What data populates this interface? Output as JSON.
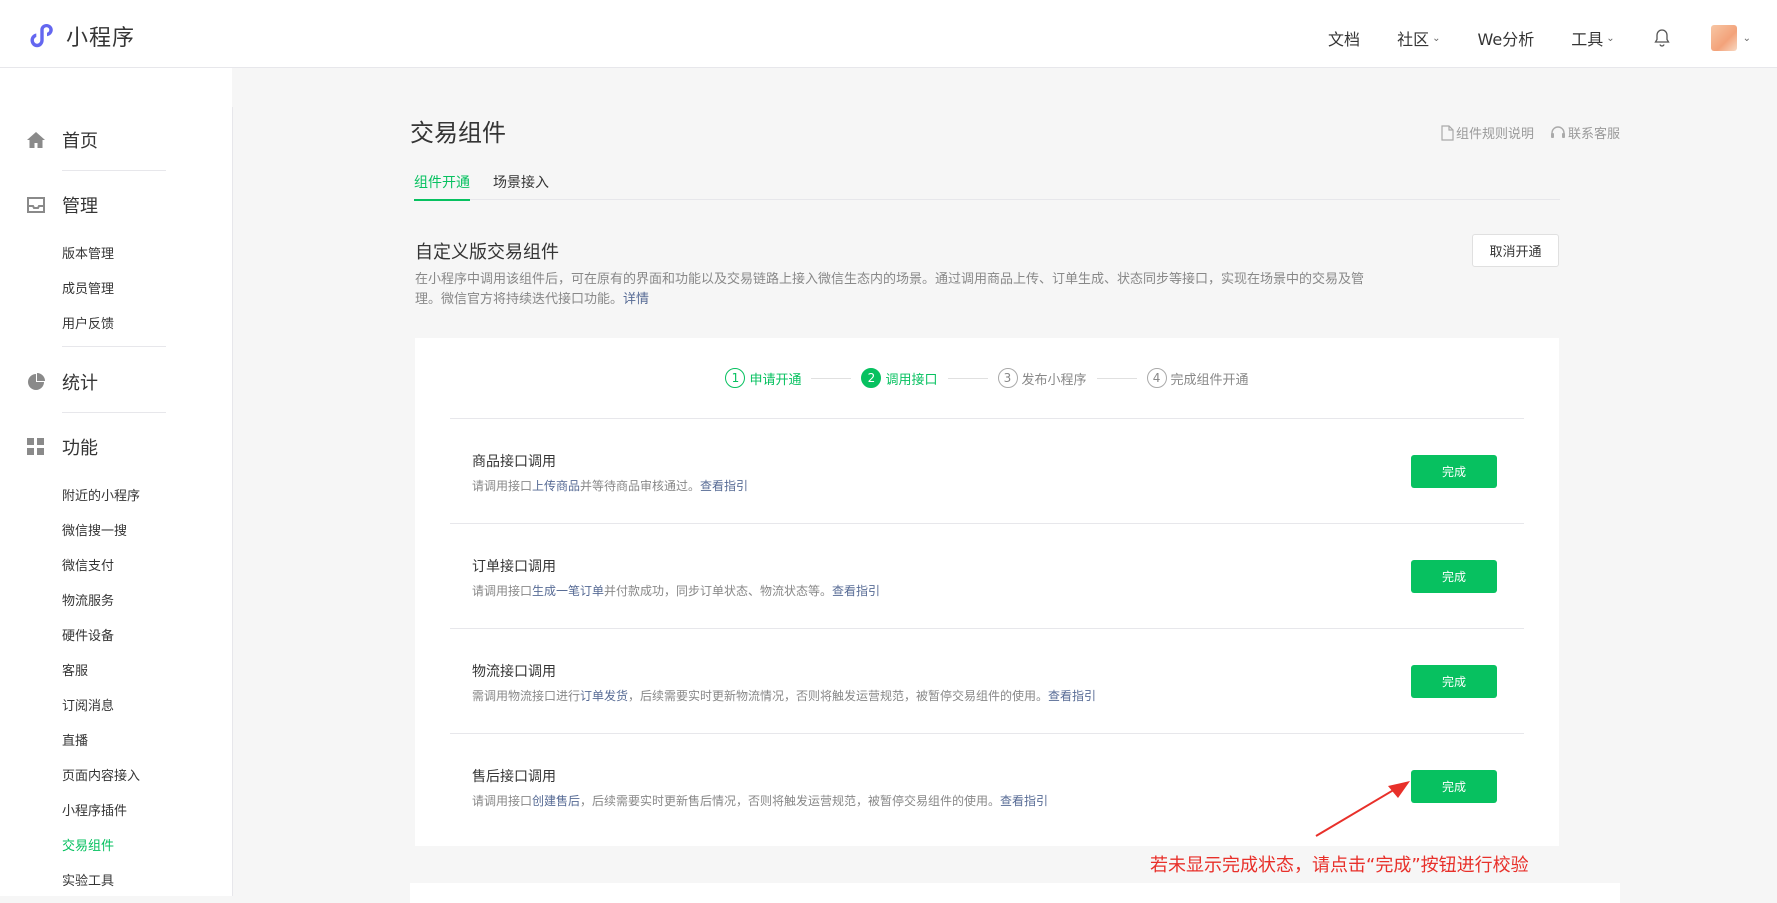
{
  "header": {
    "logo_text": "小程序",
    "nav": [
      {
        "label": "文档",
        "has_dropdown": false
      },
      {
        "label": "社区",
        "has_dropdown": true
      },
      {
        "label": "We分析",
        "has_dropdown": false
      },
      {
        "label": "工具",
        "has_dropdown": true
      }
    ],
    "bell_icon": "bell-icon",
    "avatar_icon": "avatar"
  },
  "sidebar": {
    "groups": [
      {
        "label": "首页",
        "icon": "home-icon",
        "items": []
      },
      {
        "label": "管理",
        "icon": "inbox-icon",
        "items": [
          "版本管理",
          "成员管理",
          "用户反馈"
        ]
      },
      {
        "label": "统计",
        "icon": "pie-chart-icon",
        "items": []
      },
      {
        "label": "功能",
        "icon": "grid-icon",
        "items": [
          "附近的小程序",
          "微信搜一搜",
          "微信支付",
          "物流服务",
          "硬件设备",
          "客服",
          "订阅消息",
          "直播",
          "页面内容接入",
          "小程序插件",
          "交易组件",
          "实验工具"
        ]
      }
    ],
    "active_item": "交易组件"
  },
  "page": {
    "title": "交易组件",
    "links": [
      "组件规则说明",
      "联系客服"
    ],
    "tabs": [
      {
        "label": "组件开通",
        "active": true
      },
      {
        "label": "场景接入",
        "active": false
      }
    ],
    "section_title": "自定义版交易组件",
    "cancel_button": "取消开通",
    "description_line1": "在小程序中调用该组件后，可在原有的界面和功能以及交易链路上接入微信生态内的场景。通过调用商品上传、订单生成、状态同步等接口，实现在场景中的交易及管理。微",
    "description_line2": "信官方将持续迭代接口功能。",
    "description_link": "详情"
  },
  "steps": [
    {
      "num": "1",
      "label": "申请开通",
      "state": "done"
    },
    {
      "num": "2",
      "label": "调用接口",
      "state": "current"
    },
    {
      "num": "3",
      "label": "发布小程序",
      "state": "todo"
    },
    {
      "num": "4",
      "label": "完成组件开通",
      "state": "todo"
    }
  ],
  "rows": [
    {
      "title": "商品接口调用",
      "pre": "请调用接口",
      "link": "上传商品",
      "post": "并等待商品审核通过。",
      "guide": "查看指引",
      "button": "完成"
    },
    {
      "title": "订单接口调用",
      "pre": "请调用接口",
      "link": "生成一笔订单",
      "post": "并付款成功，同步订单状态、物流状态等。",
      "guide": "查看指引",
      "button": "完成"
    },
    {
      "title": "物流接口调用",
      "pre": "需调用物流接口进行",
      "link": "订单发货",
      "post": "，后续需要实时更新物流情况，否则将触发运营规范，被暂停交易组件的使用。",
      "guide": "查看指引",
      "button": "完成"
    },
    {
      "title": "售后接口调用",
      "pre": "请调用接口",
      "link": "创建售后",
      "post": "，后续需要实时更新售后情况，否则将触发运营规范，被暂停交易组件的使用。",
      "guide": "查看指引",
      "button": "完成"
    }
  ],
  "annotation": {
    "text": "若未显示完成状态，请点击“完成”按钮进行校验",
    "color": "#e8302a"
  },
  "colors": {
    "accent": "#07c160",
    "link": "#576b95"
  }
}
